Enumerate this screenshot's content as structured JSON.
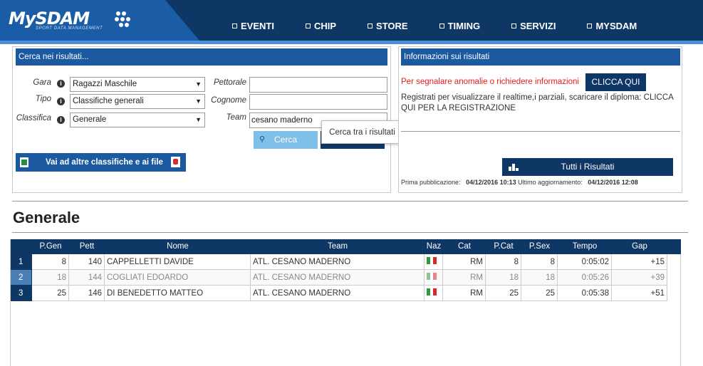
{
  "header": {
    "logo": "MySDAM",
    "logo_sub": "SPORT DATA MANAGEMENT",
    "nav": [
      "EVENTI",
      "CHIP",
      "STORE",
      "TIMING",
      "SERVIZI",
      "MYSDAM"
    ]
  },
  "search": {
    "title": "Cerca nei risultati...",
    "gara_label": "Gara",
    "gara_value": "Ragazzi Maschile",
    "tipo_label": "Tipo",
    "tipo_value": "Classifiche generali",
    "classifica_label": "Classifica",
    "classifica_value": "Generale",
    "pettorale_label": "Pettorale",
    "pettorale_value": "",
    "cognome_label": "Cognome",
    "cognome_value": "",
    "team_label": "Team",
    "team_value": "cesano maderno",
    "cerca_label": "Cerca",
    "tooltip": "Cerca tra i risultati",
    "altre_label": "Vai ad altre classifiche e ai file"
  },
  "info": {
    "title": "Informazioni sui risultati",
    "warn_text": "Per segnalare anomalie o richiedere informazioni",
    "clicca_label": "CLICCA QUI",
    "reg_text": "Registrati per visualizzare il realtime,i parziali, scaricare il diploma: CLICCA QUI PER LA REGISTRAZIONE",
    "tutti_label": "Tutti i Risultati",
    "prima_label": "Prima pubblicazione:",
    "prima_value": "04/12/2016 10:13",
    "ultimo_label": "Ultimo aggiornamento:",
    "ultimo_value": "04/12/2016 12:08"
  },
  "section_title": "Generale",
  "table": {
    "headers": [
      "P.Gen",
      "Pett",
      "Nome",
      "Team",
      "Naz",
      "Cat",
      "P.Cat",
      "P.Sex",
      "Tempo",
      "Gap"
    ],
    "rows": [
      {
        "pos": "1",
        "pgen": "8",
        "pett": "140",
        "nome": "CAPPELLETTI DAVIDE",
        "team": "ATL. CESANO MADERNO",
        "cat": "RM",
        "pcat": "8",
        "psex": "8",
        "tempo": "0:05:02",
        "gap": "+15"
      },
      {
        "pos": "2",
        "pgen": "18",
        "pett": "144",
        "nome": "COGLIATI EDOARDO",
        "team": "ATL. CESANO MADERNO",
        "cat": "RM",
        "pcat": "18",
        "psex": "18",
        "tempo": "0:05:26",
        "gap": "+39"
      },
      {
        "pos": "3",
        "pgen": "25",
        "pett": "146",
        "nome": "DI BENEDETTO MATTEO",
        "team": "ATL. CESANO MADERNO",
        "cat": "RM",
        "pcat": "25",
        "psex": "25",
        "tempo": "0:05:38",
        "gap": "+51"
      }
    ]
  },
  "colors": {
    "header_dark": "#0f3766",
    "header_blue": "#1a5da6",
    "accent": "#4a90d9",
    "warn": "#e02020"
  }
}
